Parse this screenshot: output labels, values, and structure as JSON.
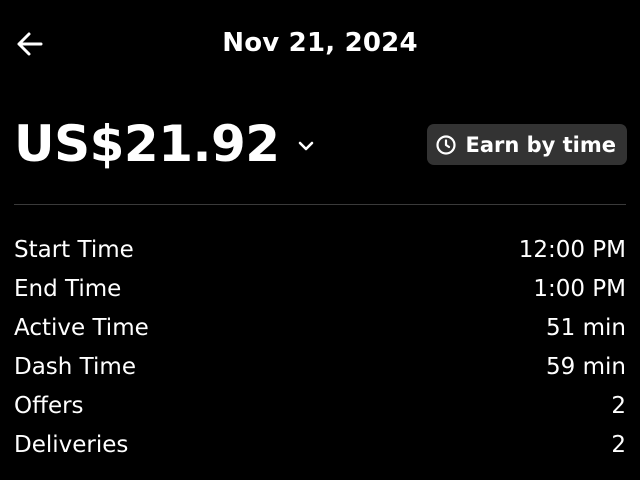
{
  "header": {
    "back_icon": "arrow-left-icon",
    "title": "Nov 21, 2024"
  },
  "summary": {
    "amount": "US$21.92",
    "chevron_icon": "chevron-down-icon",
    "earn_button": {
      "icon": "clock-icon",
      "label": "Earn by time"
    }
  },
  "details": [
    {
      "label": "Start Time",
      "value": "12:00 PM"
    },
    {
      "label": "End Time",
      "value": "1:00 PM"
    },
    {
      "label": "Active Time",
      "value": "51 min"
    },
    {
      "label": "Dash Time",
      "value": "59 min"
    },
    {
      "label": "Offers",
      "value": "2"
    },
    {
      "label": "Deliveries",
      "value": "2"
    }
  ],
  "colors": {
    "background": "#000000",
    "text": "#ffffff",
    "button_background": "#333333",
    "divider": "#3a3a3a"
  }
}
